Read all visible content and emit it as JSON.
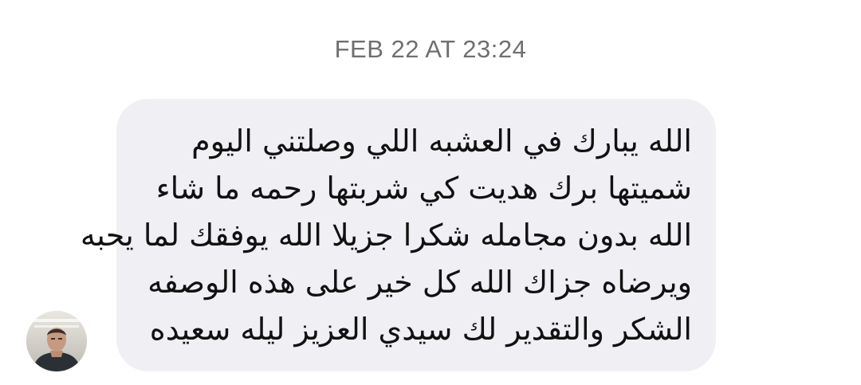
{
  "conversation": {
    "timestamp": "FEB 22 AT 23:24"
  },
  "message": {
    "lines": [
      "الله يبارك في العشبه اللي وصلتني اليوم",
      "شميتها برك هديت كي شربتها رحمه ما شاء",
      "الله بدون مجامله شكرا جزيلا الله يوفقك لما يحبه",
      "ويرضاه جزاك الله كل خير على هذه الوصفه",
      "الشكر والتقدير لك سيدي العزيز ليله سعيده"
    ]
  },
  "sender": {
    "avatar_icon": "person-photo-icon"
  }
}
